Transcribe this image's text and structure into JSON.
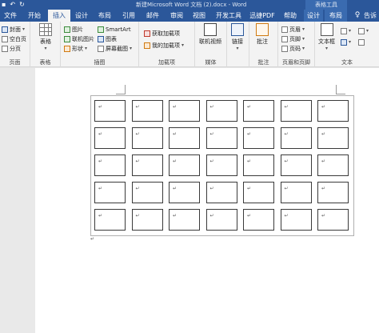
{
  "titlebar": {
    "quick_access": [
      "save-icon",
      "undo-icon",
      "redo-icon"
    ],
    "document_title": "新建Microsoft Word 文档 (2).docx - Word",
    "context_title": "表格工具",
    "background_color": "#2b579a"
  },
  "tabs": [
    {
      "label": "文件",
      "active": false,
      "contextual": false
    },
    {
      "label": "开始",
      "active": false,
      "contextual": false
    },
    {
      "label": "插入",
      "active": true,
      "contextual": false
    },
    {
      "label": "设计",
      "active": false,
      "contextual": false
    },
    {
      "label": "布局",
      "active": false,
      "contextual": false
    },
    {
      "label": "引用",
      "active": false,
      "contextual": false
    },
    {
      "label": "邮件",
      "active": false,
      "contextual": false
    },
    {
      "label": "审阅",
      "active": false,
      "contextual": false
    },
    {
      "label": "视图",
      "active": false,
      "contextual": false
    },
    {
      "label": "开发工具",
      "active": false,
      "contextual": false
    },
    {
      "label": "迅捷PDF",
      "active": false,
      "contextual": false
    },
    {
      "label": "帮助",
      "active": false,
      "contextual": false
    },
    {
      "label": "设计",
      "active": false,
      "contextual": true
    },
    {
      "label": "布局",
      "active": false,
      "contextual": true
    }
  ],
  "tell_me": {
    "icon": "lightbulb-icon",
    "label": "告诉"
  },
  "ribbon": {
    "pages": {
      "items": [
        "封面",
        "空白页",
        "分页"
      ],
      "label": "页面"
    },
    "tables": {
      "button": "表格",
      "label": "表格"
    },
    "illustrations": {
      "items": [
        "图片",
        "联机图片",
        "形状",
        "SmartArt",
        "图表",
        "屏幕截图"
      ],
      "label": "插图"
    },
    "addins": {
      "items": [
        "获取加载项",
        "我的加载项"
      ],
      "label": "加载项"
    },
    "media": {
      "button": "联机视频",
      "label": "媒体"
    },
    "links": {
      "button": "链接"
    },
    "comments": {
      "button": "批注",
      "label": "批注"
    },
    "header_footer": {
      "items": [
        "页眉",
        "页脚",
        "页码"
      ],
      "label": "页眉和页脚"
    },
    "text": {
      "button": "文本框",
      "label": "文本"
    }
  },
  "document": {
    "table": {
      "rows": 5,
      "columns": 7,
      "cell_mark": "↵"
    },
    "paragraph_mark": "↵"
  }
}
